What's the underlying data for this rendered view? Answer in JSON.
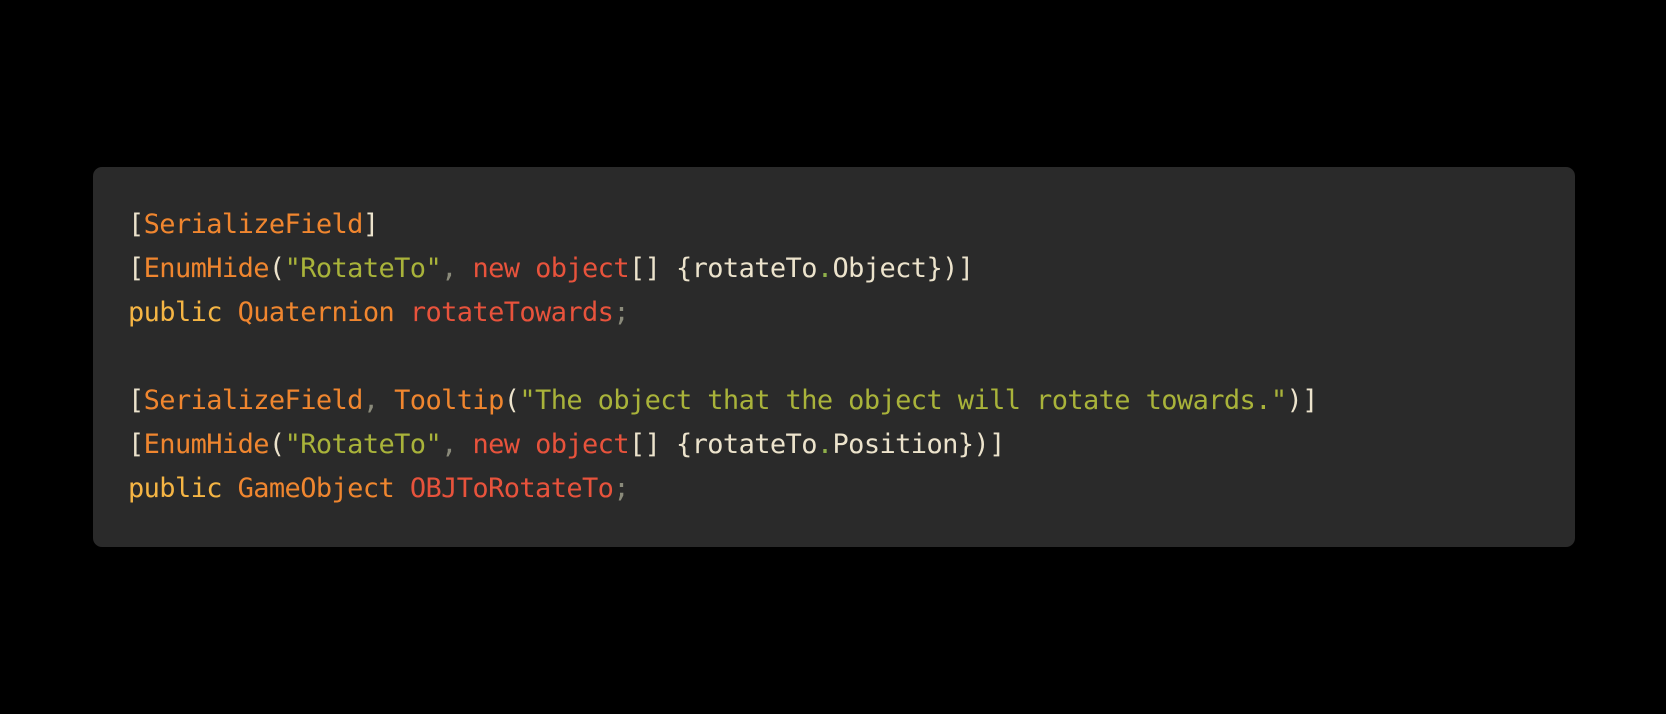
{
  "colors": {
    "page_background": "#000000",
    "code_background": "#2a2a2a",
    "punctuation": "#ece3cc",
    "attribute": "#f0862f",
    "string": "#a9b33a",
    "keyword": "#e8533c",
    "type": "#f0862f",
    "identifier": "#e8533c",
    "comma": "#8a8a7a",
    "member_dot": "#8fb04a",
    "public_keyword": "#f5b544"
  },
  "code": {
    "language": "C#",
    "lines": [
      [
        {
          "text": "[",
          "role": "punctuation"
        },
        {
          "text": "SerializeField",
          "role": "attribute"
        },
        {
          "text": "]",
          "role": "punctuation"
        }
      ],
      [
        {
          "text": "[",
          "role": "punctuation"
        },
        {
          "text": "EnumHide",
          "role": "attribute"
        },
        {
          "text": "(",
          "role": "punctuation"
        },
        {
          "text": "\"RotateTo\"",
          "role": "string"
        },
        {
          "text": ", ",
          "role": "comma"
        },
        {
          "text": "new",
          "role": "keyword"
        },
        {
          "text": " ",
          "role": "punctuation"
        },
        {
          "text": "object",
          "role": "keyword"
        },
        {
          "text": "[] {",
          "role": "punctuation"
        },
        {
          "text": "rotateTo",
          "role": "punctuation"
        },
        {
          "text": ".",
          "role": "member_dot"
        },
        {
          "text": "Object",
          "role": "punctuation"
        },
        {
          "text": "})]",
          "role": "punctuation"
        }
      ],
      [
        {
          "text": "public",
          "role": "public_keyword"
        },
        {
          "text": " ",
          "role": "punctuation"
        },
        {
          "text": "Quaternion",
          "role": "type"
        },
        {
          "text": " ",
          "role": "punctuation"
        },
        {
          "text": "rotateTowards",
          "role": "identifier"
        },
        {
          "text": ";",
          "role": "comma"
        }
      ],
      [],
      [
        {
          "text": "[",
          "role": "punctuation"
        },
        {
          "text": "SerializeField",
          "role": "attribute"
        },
        {
          "text": ", ",
          "role": "comma"
        },
        {
          "text": "Tooltip",
          "role": "attribute"
        },
        {
          "text": "(",
          "role": "punctuation"
        },
        {
          "text": "\"The object that the object will rotate towards.\"",
          "role": "string"
        },
        {
          "text": ")]",
          "role": "punctuation"
        }
      ],
      [
        {
          "text": "[",
          "role": "punctuation"
        },
        {
          "text": "EnumHide",
          "role": "attribute"
        },
        {
          "text": "(",
          "role": "punctuation"
        },
        {
          "text": "\"RotateTo\"",
          "role": "string"
        },
        {
          "text": ", ",
          "role": "comma"
        },
        {
          "text": "new",
          "role": "keyword"
        },
        {
          "text": " ",
          "role": "punctuation"
        },
        {
          "text": "object",
          "role": "keyword"
        },
        {
          "text": "[] {",
          "role": "punctuation"
        },
        {
          "text": "rotateTo",
          "role": "punctuation"
        },
        {
          "text": ".",
          "role": "member_dot"
        },
        {
          "text": "Position",
          "role": "punctuation"
        },
        {
          "text": "})]",
          "role": "punctuation"
        }
      ],
      [
        {
          "text": "public",
          "role": "public_keyword"
        },
        {
          "text": " ",
          "role": "punctuation"
        },
        {
          "text": "GameObject",
          "role": "type"
        },
        {
          "text": " ",
          "role": "punctuation"
        },
        {
          "text": "OBJToRotateTo",
          "role": "identifier"
        },
        {
          "text": ";",
          "role": "comma"
        }
      ]
    ]
  }
}
